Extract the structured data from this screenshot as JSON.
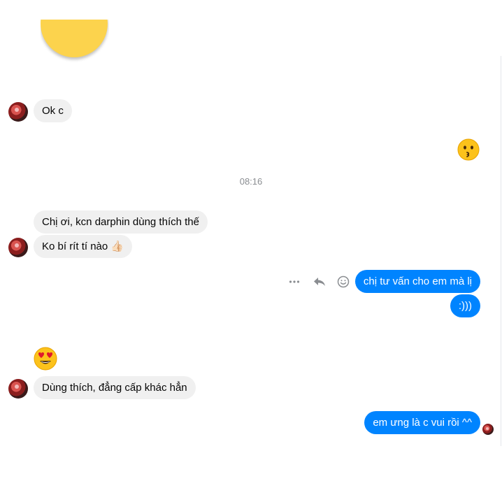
{
  "conversation": {
    "timestamp": "08:16",
    "messages": [
      {
        "id": "m1",
        "sender": "them",
        "text": "Ok c"
      },
      {
        "id": "m2",
        "sender": "me",
        "emoji": "kissing-face"
      },
      {
        "id": "m3",
        "sender": "them",
        "text": "Chị ơi, kcn darphin dùng thích thế"
      },
      {
        "id": "m4",
        "sender": "them",
        "text": "Ko bí rít tí nào 👍🏻"
      },
      {
        "id": "m5",
        "sender": "me",
        "text": "chị tư vấn cho em mà lị"
      },
      {
        "id": "m6",
        "sender": "me",
        "text": ":)))"
      },
      {
        "id": "m7",
        "sender": "them",
        "emoji": "heart-eyes-face"
      },
      {
        "id": "m8",
        "sender": "them",
        "text": "Dùng thích, đẳng cấp khác hẳn"
      },
      {
        "id": "m9",
        "sender": "me",
        "text": "em ưng là c vui rồi ^^"
      }
    ]
  },
  "actions": {
    "more_icon": "more-horizontal",
    "reply_icon": "reply-arrow",
    "react_icon": "smiley"
  },
  "colors": {
    "outgoing_bubble": "#0084ff",
    "incoming_bubble": "#f0f0f0",
    "timestamp_text": "#8a8d91"
  }
}
